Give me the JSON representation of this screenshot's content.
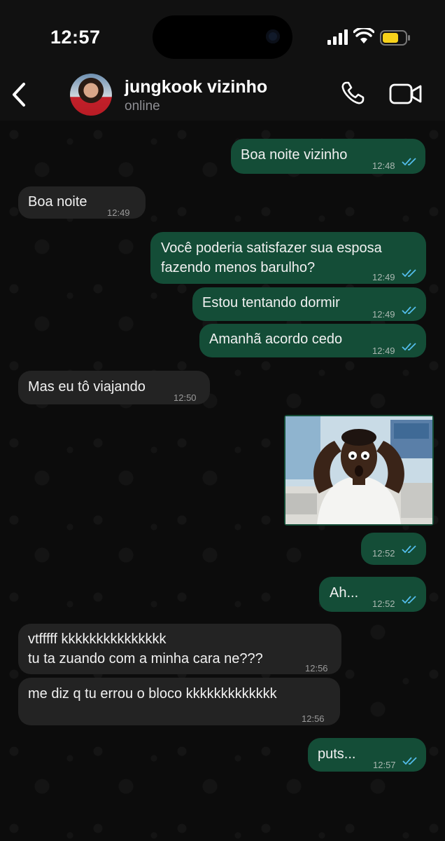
{
  "status": {
    "time": "12:57"
  },
  "header": {
    "contact_name": "jungkook vizinho",
    "contact_status": "online"
  },
  "colors": {
    "outgoing_bubble": "#144d37",
    "incoming_bubble": "#232323",
    "read_ticks": "#53bdeb"
  },
  "messages": [
    {
      "dir": "out",
      "text": "Boa noite vizinho",
      "time": "12:48",
      "read": true
    },
    {
      "dir": "in",
      "text": "Boa noite",
      "time": "12:49"
    },
    {
      "dir": "out",
      "text": "Você poderia satisfazer sua esposa\nfazendo menos barulho?",
      "time": "12:49",
      "read": true
    },
    {
      "dir": "out",
      "text": "Estou tentando dormir",
      "time": "12:49",
      "read": true
    },
    {
      "dir": "out",
      "text": "Amanhã acordo cedo",
      "time": "12:49",
      "read": true
    },
    {
      "dir": "in",
      "text": "Mas eu tô viajando",
      "time": "12:50"
    },
    {
      "dir": "out",
      "type": "image",
      "time": "12:52",
      "read": true
    },
    {
      "dir": "out",
      "text": "Ah...",
      "time": "12:52",
      "read": true
    },
    {
      "dir": "in",
      "text": "vtfffff kkkkkkkkkkkkkkk\ntu ta zuando com a minha cara ne???",
      "time": "12:56"
    },
    {
      "dir": "in",
      "text": "me diz q tu errou o bloco kkkkkkkkkkkkk",
      "time": "12:56"
    },
    {
      "dir": "out",
      "text": "puts...",
      "time": "12:57",
      "read": true
    }
  ]
}
